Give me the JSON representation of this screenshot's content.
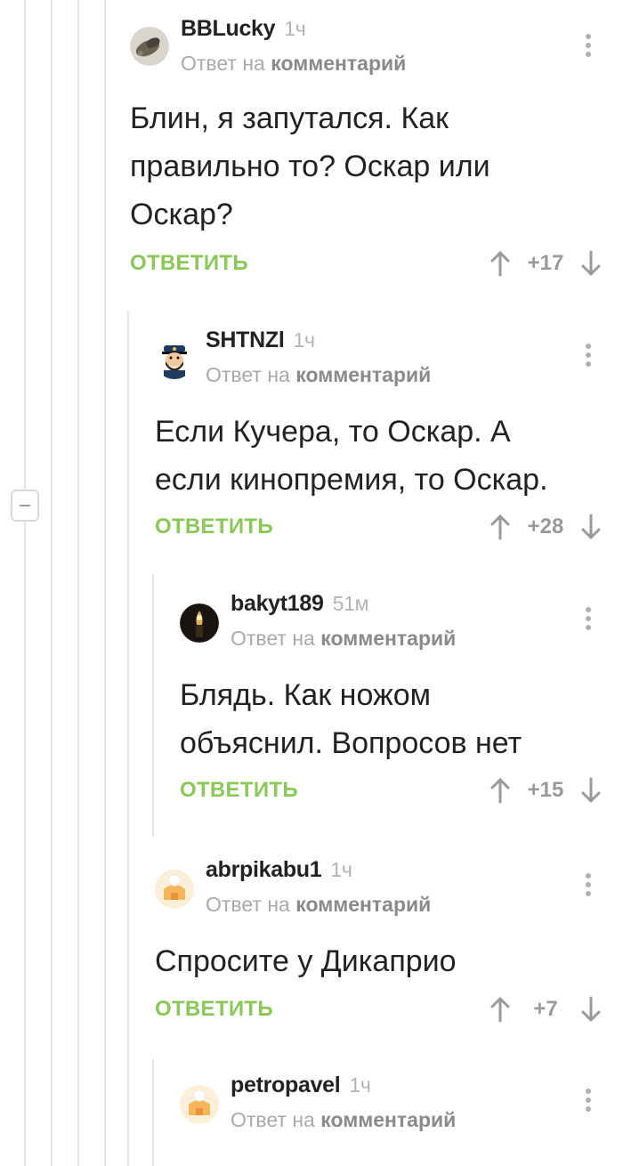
{
  "reply_to_prefix": "Ответ на",
  "reply_to_target": "комментарий",
  "reply_label": "ОТВЕТИТЬ",
  "colors": {
    "accent_green": "#8ac858",
    "muted_gray": "#aaaaaa",
    "thread_line": "#e5e5e5"
  },
  "icons": {
    "menu": "more-vertical-icon",
    "upvote": "arrow-up-icon",
    "downvote": "arrow-down-icon",
    "collapse": "collapse-minus-icon"
  },
  "comments": [
    {
      "username": "BBLucky",
      "time": "1ч",
      "text": "Блин, я запутался. Как\nправильно то? Оскар или\nОскар?",
      "rating": "+17",
      "avatar": "photo-avatar"
    },
    {
      "username": "SHTNZl",
      "time": "1ч",
      "text": "Если Кучера, то Оскар. А\nесли кинопремия, то Оскар.",
      "rating": "+28",
      "avatar": "captain-avatar"
    },
    {
      "username": "bakyt189",
      "time": "51м",
      "text": "Блядь. Как ножом\nобъяснил. Вопросов нет",
      "rating": "+15",
      "avatar": "dark-avatar"
    },
    {
      "username": "abrpikabu1",
      "time": "1ч",
      "text": "Спросите у Дикаприо",
      "rating": "+7",
      "avatar": "default-avatar"
    },
    {
      "username": "petropavel",
      "time": "1ч",
      "text": "",
      "rating": "",
      "avatar": "default-avatar"
    }
  ]
}
